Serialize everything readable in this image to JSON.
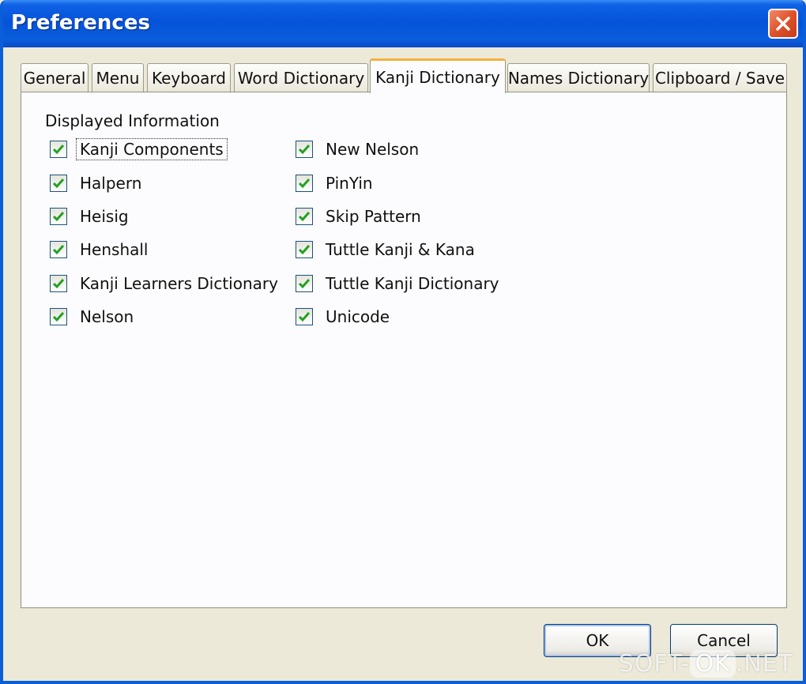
{
  "window": {
    "title": "Preferences"
  },
  "tabs": [
    {
      "label": "General"
    },
    {
      "label": "Menu"
    },
    {
      "label": "Keyboard"
    },
    {
      "label": "Word Dictionary"
    },
    {
      "label": "Kanji Dictionary",
      "active": true
    },
    {
      "label": "Names Dictionary"
    },
    {
      "label": "Clipboard / Save"
    }
  ],
  "panel": {
    "group_label": "Displayed Information",
    "left_column": [
      {
        "label": "Kanji Components",
        "checked": true
      },
      {
        "label": "Halpern",
        "checked": true
      },
      {
        "label": "Heisig",
        "checked": true
      },
      {
        "label": "Henshall",
        "checked": true
      },
      {
        "label": "Kanji Learners Dictionary",
        "checked": true
      },
      {
        "label": "Nelson",
        "checked": true
      }
    ],
    "right_column": [
      {
        "label": "New Nelson",
        "checked": true
      },
      {
        "label": "PinYin",
        "checked": true
      },
      {
        "label": "Skip Pattern",
        "checked": true
      },
      {
        "label": "Tuttle Kanji & Kana",
        "checked": true
      },
      {
        "label": "Tuttle Kanji Dictionary",
        "checked": true
      },
      {
        "label": "Unicode",
        "checked": true
      }
    ]
  },
  "buttons": {
    "ok": "OK",
    "cancel": "Cancel"
  },
  "watermark": {
    "left": "SOFT-",
    "mid": "OK",
    "right": ".NET"
  },
  "colors": {
    "titlebar": "#0553d8",
    "tab_highlight": "#f4b23c",
    "check": "#21a121",
    "close_button": "#e0522c"
  }
}
